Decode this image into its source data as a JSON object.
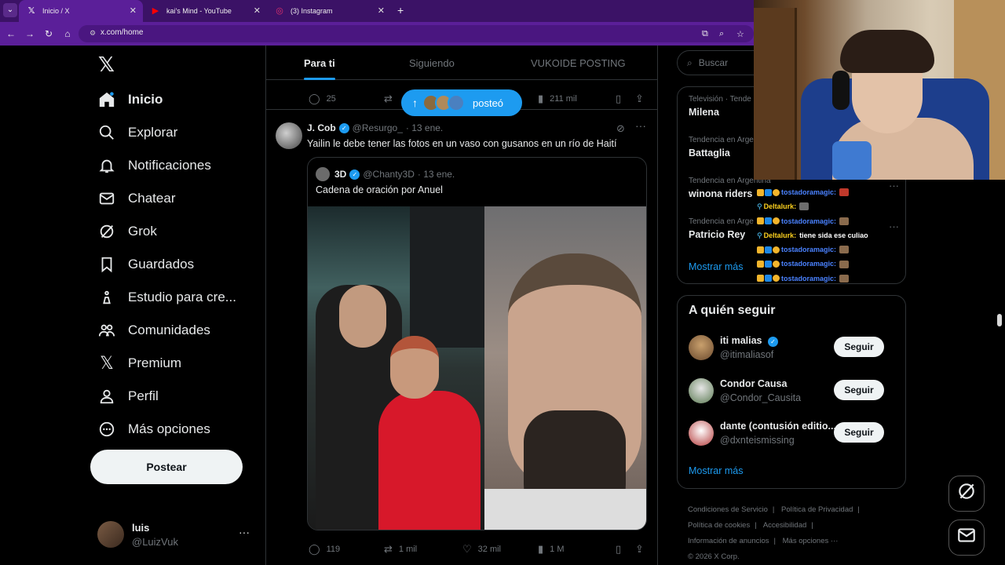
{
  "browser": {
    "tabs": [
      {
        "icon": "x-logo-icon",
        "title": "Inicio / X",
        "active": true
      },
      {
        "icon": "youtube-icon",
        "title": "kai's Mind - YouTube",
        "active": false
      },
      {
        "icon": "instagram-icon",
        "title": "(3) Instagram",
        "active": false
      }
    ],
    "new_tab": "+",
    "url": "x.com/home"
  },
  "sidebar": {
    "logo": "𝕏",
    "items": [
      {
        "label": "Inicio",
        "icon": "home-icon"
      },
      {
        "label": "Explorar",
        "icon": "search-icon"
      },
      {
        "label": "Notificaciones",
        "icon": "bell-icon"
      },
      {
        "label": "Chatear",
        "icon": "mail-icon"
      },
      {
        "label": "Grok",
        "icon": "grok-icon"
      },
      {
        "label": "Guardados",
        "icon": "bookmark-icon"
      },
      {
        "label": "Estudio para cre...",
        "icon": "creator-studio-icon"
      },
      {
        "label": "Comunidades",
        "icon": "communities-icon"
      },
      {
        "label": "Premium",
        "icon": "x-premium-icon"
      },
      {
        "label": "Perfil",
        "icon": "profile-icon"
      },
      {
        "label": "Más opciones",
        "icon": "more-options-icon"
      }
    ],
    "post_button": "Postear",
    "profile": {
      "name": "luis",
      "handle": "@LuizVuk",
      "more": "···"
    }
  },
  "feed": {
    "tabs": [
      "Para ti",
      "Siguiendo",
      "VUKOIDE POSTING"
    ],
    "prev_tweet_actions": {
      "replies": "25",
      "views": "211 mil"
    },
    "new_posts_pill": {
      "label": "posteó"
    },
    "tweet": {
      "name": "J. Cob",
      "handle": "@Resurgo_",
      "date": "· 13 ene.",
      "text": "Yailin le debe tener las fotos en un vaso con gusanos en un río de Haití",
      "quote": {
        "name": "3D",
        "handle": "@Chanty3D",
        "date": "· 13 ene.",
        "text": "Cadena de oración por Anuel"
      },
      "actions": {
        "replies": "119",
        "reposts": "1 mil",
        "likes": "32 mil",
        "views": "1 M"
      }
    }
  },
  "right": {
    "search_placeholder": "Buscar",
    "trends": [
      {
        "category": "Televisión · Tende",
        "name": "Milena"
      },
      {
        "category": "Tendencia en Arge",
        "name": "Battaglia"
      },
      {
        "category": "Tendencia en Argentina",
        "name": "winona riders"
      },
      {
        "category": "Tendencia en Arge",
        "name": "Patricio Rey"
      }
    ],
    "trends_show_more": "Mostrar más",
    "who_to_follow_title": "A quién seguir",
    "follow": [
      {
        "name": "iti malias",
        "handle": "@itimaliasof",
        "verified": true,
        "button": "Seguir"
      },
      {
        "name": "Condor Causa",
        "handle": "@Condor_Causita",
        "verified": false,
        "button": "Seguir"
      },
      {
        "name": "dante (contusión editio...",
        "handle": "@dxnteismissing",
        "verified": false,
        "button": "Seguir"
      }
    ],
    "follow_show_more": "Mostrar más",
    "footer": [
      "Condiciones de Servicio",
      "|",
      "Política de Privacidad",
      "|",
      "Política de cookies",
      "|",
      "Accesibilidad",
      "|",
      "Información de anuncios",
      "|",
      "Más opciones ···",
      "© 2026 X Corp."
    ]
  },
  "chat_overlay": [
    {
      "user": "tostadoramagic:",
      "message": "",
      "badges": "crown-mod-one"
    },
    {
      "user": "Deltalurk:",
      "message": "",
      "badges": "pin"
    },
    {
      "user": "tostadoramagic:",
      "message": "",
      "badges": "crown-mod-one"
    },
    {
      "user": "Deltalurk:",
      "message": "tiene sida ese culiao",
      "badges": "pin"
    },
    {
      "user": "tostadoramagic:",
      "message": "",
      "badges": "crown-mod-one"
    },
    {
      "user": "tostadoramagic:",
      "message": "",
      "badges": "crown-mod-one"
    },
    {
      "user": "tostadoramagic:",
      "message": "",
      "badges": "crown-mod-one"
    }
  ],
  "colors": {
    "accent": "#1d9bf0",
    "browser": "#5b1f99",
    "background": "#000000"
  }
}
